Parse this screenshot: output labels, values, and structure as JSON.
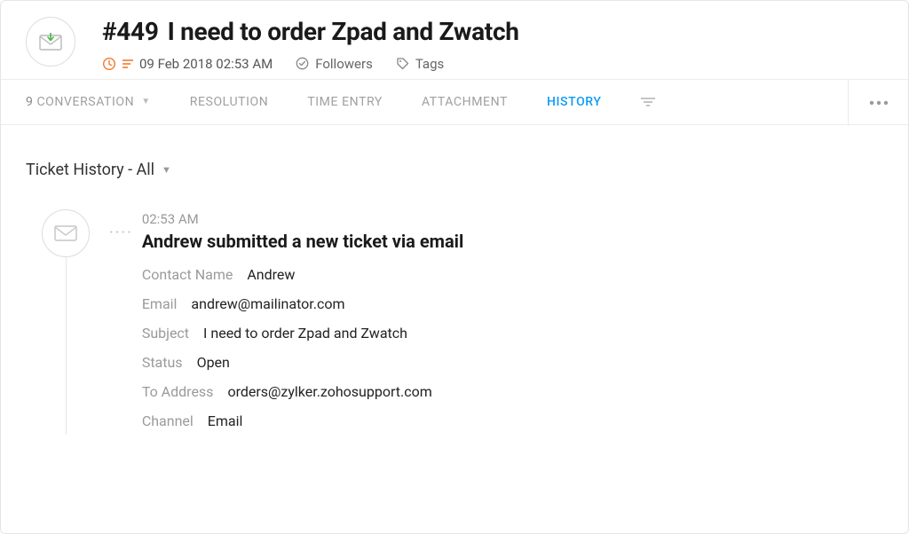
{
  "ticket": {
    "number": "#449",
    "title": "I need to order Zpad and Zwatch",
    "datetime": "09 Feb 2018 02:53 AM"
  },
  "meta": {
    "followers": "Followers",
    "tags": "Tags"
  },
  "tabs": {
    "conversation_count": "9",
    "conversation": "CONVERSATION",
    "resolution": "RESOLUTION",
    "time_entry": "TIME ENTRY",
    "attachment": "ATTACHMENT",
    "history": "HISTORY"
  },
  "filter": {
    "label": "Ticket History - All"
  },
  "event": {
    "time": "02:53 AM",
    "title": "Andrew submitted a new ticket via email",
    "fields": {
      "contact_name": {
        "label": "Contact Name",
        "value": "Andrew"
      },
      "email": {
        "label": "Email",
        "value": "andrew@mailinator.com"
      },
      "subject": {
        "label": "Subject",
        "value": "I need to order Zpad and Zwatch"
      },
      "status": {
        "label": "Status",
        "value": "Open"
      },
      "to_address": {
        "label": "To Address",
        "value": "orders@zylker.zohosupport.com"
      },
      "channel": {
        "label": "Channel",
        "value": "Email"
      }
    }
  }
}
